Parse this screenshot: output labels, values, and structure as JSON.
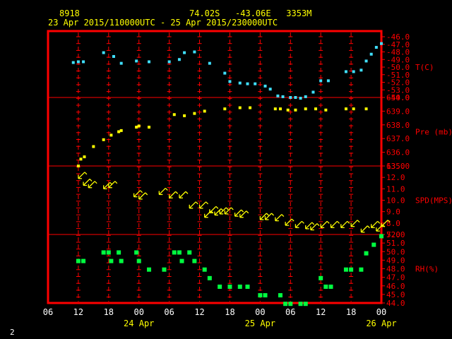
{
  "header": {
    "station_id": "8918",
    "location": "74.02S   -43.06E   3353M",
    "time_range": "23 Apr 2015/110000UTC - 25 Apr 2015/230000UTC"
  },
  "page_number": "2",
  "chart_data": {
    "type": "scatter",
    "x_unit": "hours from 23 Apr 06 UTC",
    "x_range": [
      6,
      72
    ],
    "x_tick_labels": [
      "06",
      "12",
      "18",
      "00",
      "06",
      "12",
      "18",
      "00",
      "06",
      "12",
      "18",
      "00"
    ],
    "date_labels": [
      {
        "x_hour": 24,
        "text": "24 Apr"
      },
      {
        "x_hour": 48,
        "text": "25 Apr"
      },
      {
        "x_hour": 72,
        "text": "26 Apr"
      }
    ],
    "grid": true,
    "panels": [
      {
        "name": "T(C)",
        "color": "#40e0ff",
        "ylim": [
          -54,
          -46
        ],
        "y_ticks": [
          "-46.0",
          "-47.0",
          "-48.0",
          "-49.0",
          "-50.0",
          "-51.0",
          "-52.0",
          "-53.0",
          "-54.0"
        ],
        "points": [
          [
            11,
            -49.4
          ],
          [
            12,
            -49.3
          ],
          [
            13,
            -49.3
          ],
          [
            17,
            -48.1
          ],
          [
            19,
            -48.6
          ],
          [
            20.5,
            -49.5
          ],
          [
            23.5,
            -49.2
          ],
          [
            26,
            -49.3
          ],
          [
            30,
            -49.3
          ],
          [
            32,
            -49.0
          ],
          [
            33,
            -48.1
          ],
          [
            35,
            -48.0
          ],
          [
            38,
            -49.5
          ],
          [
            41,
            -50.8
          ],
          [
            42,
            -51.9
          ],
          [
            44,
            -52.1
          ],
          [
            45.5,
            -52.2
          ],
          [
            47,
            -52.2
          ],
          [
            49,
            -52.5
          ],
          [
            50,
            -52.9
          ],
          [
            51.5,
            -53.8
          ],
          [
            52.5,
            -53.9
          ],
          [
            54,
            -54.0
          ],
          [
            55,
            -54.0
          ],
          [
            56,
            -54.1
          ],
          [
            57,
            -53.9
          ],
          [
            58.5,
            -53.3
          ],
          [
            60,
            -51.8
          ],
          [
            61.5,
            -51.8
          ],
          [
            65,
            -50.6
          ],
          [
            66.5,
            -50.6
          ],
          [
            68,
            -50.4
          ],
          [
            69,
            -49.2
          ],
          [
            70,
            -48.3
          ],
          [
            71,
            -47.4
          ],
          [
            72,
            -46.9
          ]
        ]
      },
      {
        "name": "Pre (mb)",
        "color": "#ffff00",
        "ylim": [
          635,
          641
        ],
        "y_ticks": [
          "640.0",
          "639.0",
          "638.0",
          "637.0",
          "636.0",
          "635.0"
        ],
        "points": [
          [
            12,
            635.0
          ],
          [
            12.5,
            635.6
          ],
          [
            13.2,
            635.8
          ],
          [
            15,
            636.7
          ],
          [
            17,
            637.3
          ],
          [
            18.5,
            637.7
          ],
          [
            20,
            638.0
          ],
          [
            20.5,
            638.1
          ],
          [
            23.5,
            638.4
          ],
          [
            24,
            638.5
          ],
          [
            26,
            638.4
          ],
          [
            31,
            639.5
          ],
          [
            33,
            639.4
          ],
          [
            35,
            639.6
          ],
          [
            37,
            639.8
          ],
          [
            41,
            640.0
          ],
          [
            44,
            640.1
          ],
          [
            46,
            640.1
          ],
          [
            51,
            640.0
          ],
          [
            52,
            640.0
          ],
          [
            53.5,
            639.9
          ],
          [
            55,
            639.9
          ],
          [
            57,
            640.0
          ],
          [
            59,
            640.0
          ],
          [
            61,
            639.9
          ],
          [
            65,
            640.0
          ],
          [
            66.5,
            640.0
          ],
          [
            69,
            640.0
          ]
        ]
      },
      {
        "name": "SPD(MPS)",
        "color": "#ffff00",
        "ylim": [
          7,
          13
        ],
        "y_ticks": [
          "13.0",
          "12.0",
          "11.0",
          "10.0",
          "9.0",
          "8.0",
          "7.0"
        ],
        "points": [
          [
            12,
            11.9
          ],
          [
            13,
            11.3
          ],
          [
            14,
            11.1
          ],
          [
            17,
            11.0
          ],
          [
            18,
            11.1
          ],
          [
            23,
            10.3
          ],
          [
            24,
            10.1
          ],
          [
            28,
            10.5
          ],
          [
            30,
            10.2
          ],
          [
            32,
            10.2
          ],
          [
            34,
            9.3
          ],
          [
            36,
            9.3
          ],
          [
            37,
            8.5
          ],
          [
            38,
            8.9
          ],
          [
            39,
            8.7
          ],
          [
            40,
            8.8
          ],
          [
            41,
            8.8
          ],
          [
            43,
            8.6
          ],
          [
            44,
            8.5
          ],
          [
            48,
            8.3
          ],
          [
            49,
            8.3
          ],
          [
            51,
            8.2
          ],
          [
            53,
            7.8
          ],
          [
            55,
            7.6
          ],
          [
            57,
            7.5
          ],
          [
            58,
            7.4
          ],
          [
            60,
            7.6
          ],
          [
            62,
            7.6
          ],
          [
            64,
            7.6
          ],
          [
            66,
            7.7
          ],
          [
            68,
            7.2
          ],
          [
            70,
            7.6
          ],
          [
            71,
            7.3
          ],
          [
            72,
            7.7
          ]
        ]
      },
      {
        "name": "RH(%)",
        "color": "#00ff40",
        "ylim": [
          44,
          52
        ],
        "y_ticks": [
          "52.0",
          "51.0",
          "50.0",
          "49.0",
          "48.0",
          "47.0",
          "46.0",
          "45.0",
          "44.0"
        ],
        "points": [
          [
            12,
            48.9
          ],
          [
            13,
            48.9
          ],
          [
            17,
            49.9
          ],
          [
            18,
            49.9
          ],
          [
            18.5,
            48.9
          ],
          [
            20,
            49.9
          ],
          [
            20.5,
            48.9
          ],
          [
            23.5,
            49.9
          ],
          [
            24,
            48.9
          ],
          [
            26,
            47.9
          ],
          [
            29,
            47.9
          ],
          [
            31,
            49.9
          ],
          [
            32,
            49.9
          ],
          [
            32.5,
            48.9
          ],
          [
            34,
            49.9
          ],
          [
            35,
            48.9
          ],
          [
            37,
            47.9
          ],
          [
            38,
            46.9
          ],
          [
            40,
            45.9
          ],
          [
            42,
            45.9
          ],
          [
            44,
            45.9
          ],
          [
            45.5,
            45.9
          ],
          [
            48,
            44.9
          ],
          [
            49,
            44.9
          ],
          [
            52,
            44.9
          ],
          [
            53,
            43.9
          ],
          [
            54,
            43.9
          ],
          [
            56,
            43.9
          ],
          [
            57,
            43.9
          ],
          [
            60,
            46.9
          ],
          [
            61,
            45.9
          ],
          [
            62,
            45.9
          ],
          [
            65,
            47.9
          ],
          [
            66,
            47.9
          ],
          [
            68,
            47.9
          ],
          [
            69,
            49.8
          ],
          [
            70.5,
            50.8
          ],
          [
            72,
            51.8
          ]
        ]
      }
    ]
  }
}
